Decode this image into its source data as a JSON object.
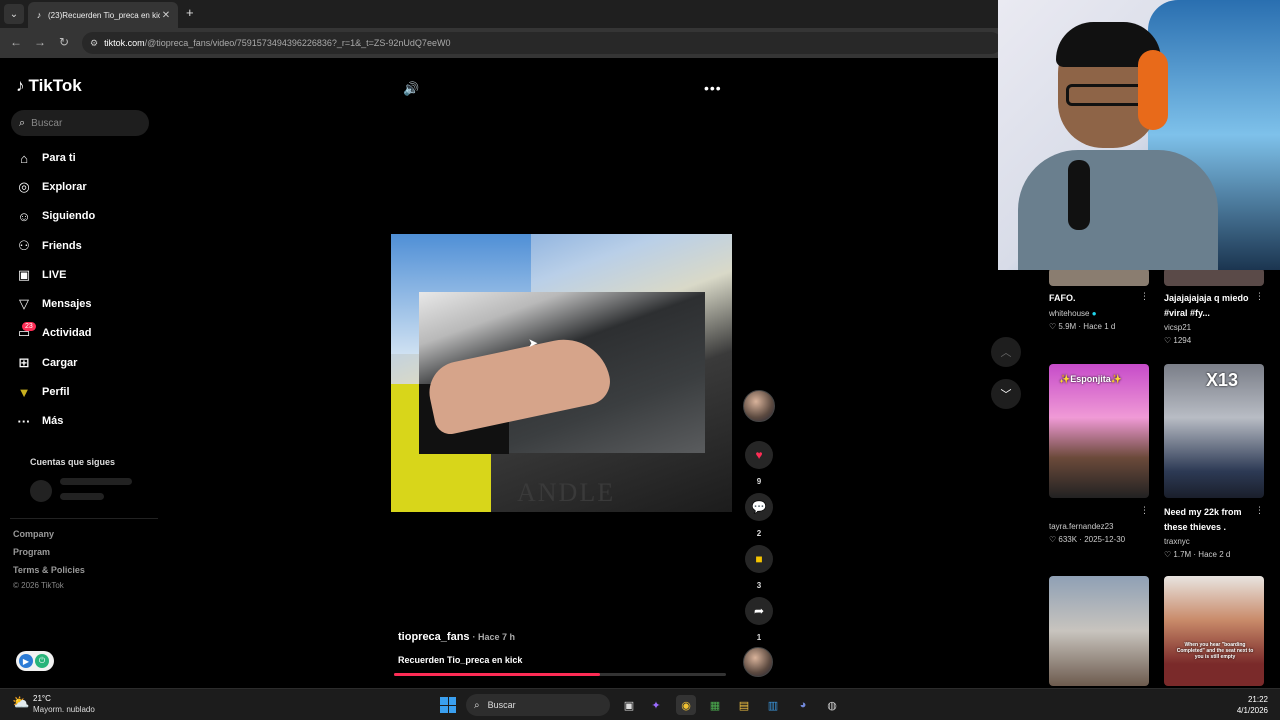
{
  "browser": {
    "tab_title": "(23)Recuerden Tio_preca en kick",
    "url_host": "tiktok.com",
    "url_path": "/@tiopreca_fans/video/7591573494396226836?_r=1&_t=ZS-92nUdQ7eeW0"
  },
  "sidebar": {
    "brand": "TikTok",
    "search_placeholder": "Buscar",
    "items": [
      {
        "label": "Para ti",
        "icon": "home-icon"
      },
      {
        "label": "Explorar",
        "icon": "compass-icon"
      },
      {
        "label": "Siguiendo",
        "icon": "following-icon"
      },
      {
        "label": "Friends",
        "icon": "friends-icon"
      },
      {
        "label": "LIVE",
        "icon": "live-icon"
      },
      {
        "label": "Mensajes",
        "icon": "messages-icon"
      },
      {
        "label": "Actividad",
        "icon": "activity-icon"
      },
      {
        "label": "Cargar",
        "icon": "upload-icon"
      },
      {
        "label": "Perfil",
        "icon": "profile-icon"
      },
      {
        "label": "Más",
        "icon": "more-icon"
      }
    ],
    "activity_badge": "23",
    "following_section_title": "Cuentas que sigues",
    "footer_links": [
      "Company",
      "Program",
      "Terms & Policies"
    ],
    "copyright": "© 2026 TikTok"
  },
  "video": {
    "author": "tiopreca_fans",
    "posted": "· Hace 7 h",
    "caption": "Recuerden Tio_preca en kick",
    "watermark": "ANDLE",
    "progress": 0.62,
    "likes": "9",
    "comments": "2",
    "saves": "3",
    "shares": "1"
  },
  "grid": [
    {
      "title": "FAFO.",
      "user": "whitehouse",
      "verified": true,
      "stats": "♡ 5.9M · Hace 1 d"
    },
    {
      "title": "Jajajajajaja q miedo #viral #fy...",
      "user": "vicsp21",
      "stats": "♡ 1294"
    },
    {
      "title": "",
      "thumb_label": "✨Esponjita✨",
      "user": "tayra.fernandez23",
      "stats": "♡ 633K · 2025-12-30"
    },
    {
      "title": "Need my 22k from these thieves .",
      "thumb_label": "X13",
      "user": "traxnyc",
      "stats": "♡ 1.7M · Hace 2 d"
    },
    {
      "title": "",
      "user": "",
      "stats": ""
    },
    {
      "title": "",
      "thumb_caption": "When you hear \"boarding Completed\" and the seat next to you is still empty",
      "user": "",
      "stats": ""
    }
  ],
  "taskbar": {
    "temperature": "21°C",
    "weather": "Mayorm. nublado",
    "search_placeholder": "Buscar",
    "time": "21:22",
    "date": "4/1/2026"
  }
}
